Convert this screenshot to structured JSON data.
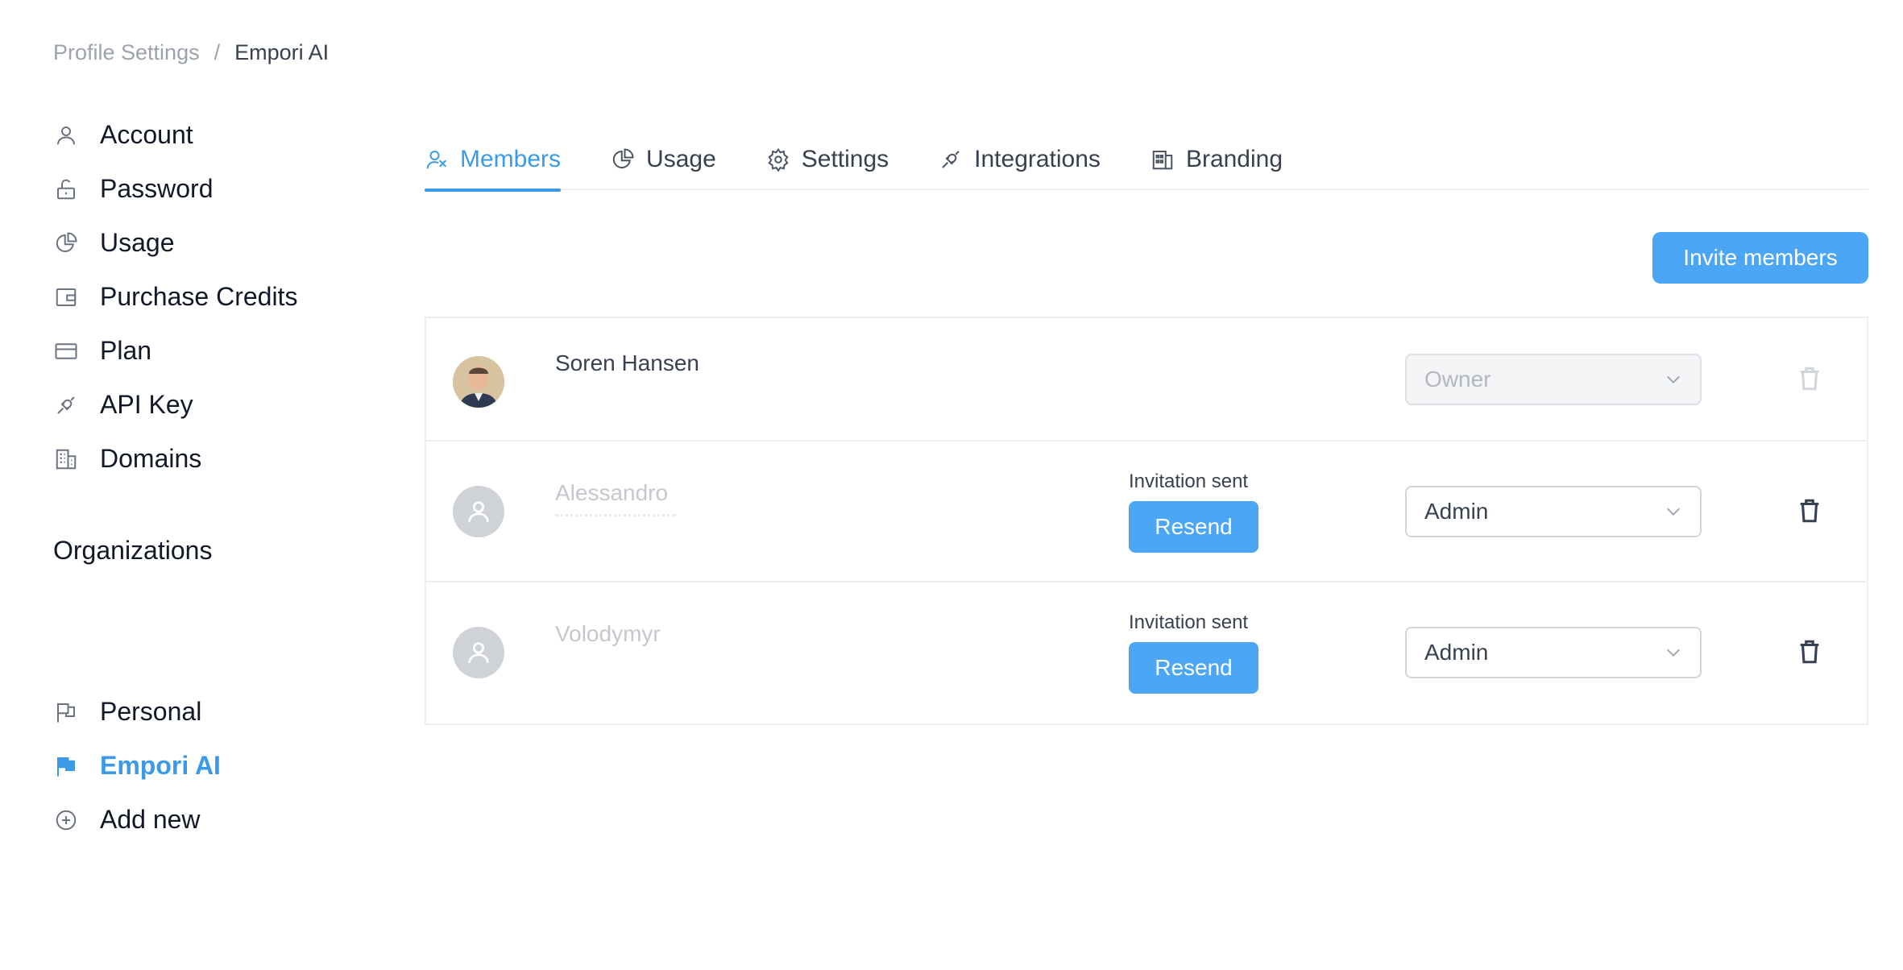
{
  "breadcrumb": {
    "parent": "Profile Settings",
    "separator": "/",
    "current": "Empori AI"
  },
  "sidebar": {
    "items": [
      {
        "label": "Account",
        "icon": "user-icon"
      },
      {
        "label": "Password",
        "icon": "lock-icon"
      },
      {
        "label": "Usage",
        "icon": "pie-chart-icon"
      },
      {
        "label": "Purchase Credits",
        "icon": "wallet-icon"
      },
      {
        "label": "Plan",
        "icon": "credit-card-icon"
      },
      {
        "label": "API Key",
        "icon": "plug-icon"
      },
      {
        "label": "Domains",
        "icon": "building-icon"
      }
    ],
    "organizations_title": "Organizations",
    "organizations": [
      {
        "label": "Personal",
        "icon": "flag-outline-icon",
        "active": false
      },
      {
        "label": "Empori AI",
        "icon": "flag-filled-icon",
        "active": true
      },
      {
        "label": "Add new",
        "icon": "plus-circle-icon",
        "active": false
      }
    ]
  },
  "tabs": [
    {
      "label": "Members",
      "icon": "members-icon",
      "active": true
    },
    {
      "label": "Usage",
      "icon": "pie-chart-icon",
      "active": false
    },
    {
      "label": "Settings",
      "icon": "gear-icon",
      "active": false
    },
    {
      "label": "Integrations",
      "icon": "plug-icon",
      "active": false
    },
    {
      "label": "Branding",
      "icon": "branding-icon",
      "active": false
    }
  ],
  "invite_button": "Invite members",
  "members": [
    {
      "name": "Soren Hansen",
      "role": "Owner",
      "role_disabled": true
    },
    {
      "name": "Alessandro",
      "status": "Invitation sent",
      "action": "Resend",
      "role": "Admin",
      "role_disabled": false
    },
    {
      "name": "Volodymyr",
      "status": "Invitation sent",
      "action": "Resend",
      "role": "Admin",
      "role_disabled": false
    }
  ],
  "colors": {
    "accent": "#4ba6f5",
    "active_text": "#3b9ae8",
    "border": "#eceef1"
  }
}
